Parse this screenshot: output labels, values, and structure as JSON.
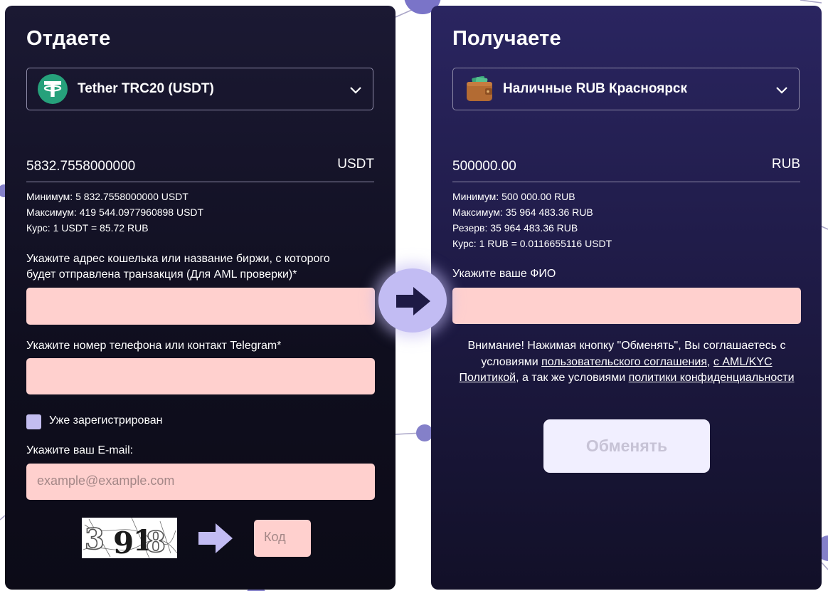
{
  "colors": {
    "input_bg": "#ffd0ce",
    "accent": "#c2bcf3",
    "tether_green": "#26a17b",
    "button_bg": "#f1efff",
    "button_text": "#c7c3d6"
  },
  "give": {
    "title": "Отдаете",
    "currency": {
      "name": "Tether TRC20 (USDT)",
      "icon": "tether-icon"
    },
    "amount": "5832.7558000000",
    "amount_currency": "USDT",
    "min": "Минимум: 5 832.7558000000 USDT",
    "max": "Максимум: 419 544.0977960898 USDT",
    "rate": "Курс: 1 USDT = 85.72 RUB",
    "wallet_label_line1": "Укажите адрес кошелька или название биржи, с которого",
    "wallet_label_line2": "будет отправлена транзакция (Для AML проверки)*",
    "wallet_value": "",
    "phone_label": "Укажите номер телефона или контакт Telegram*",
    "phone_value": "",
    "registered_label": "Уже зарегистрирован",
    "registered_checked": false,
    "email_label": "Укажите ваш E-mail:",
    "email_placeholder": "example@example.com",
    "captcha_text": "3918",
    "code_placeholder": "Код"
  },
  "get": {
    "title": "Получаете",
    "currency": {
      "name": "Наличные RUB Красноярск",
      "icon": "wallet-icon"
    },
    "amount": "500000.00",
    "amount_currency": "RUB",
    "min": "Минимум: 500 000.00 RUB",
    "max": "Максимум: 35 964 483.36 RUB",
    "reserve": "Резерв: 35 964 483.36 RUB",
    "rate": "Курс: 1 RUB = 0.0116655116 USDT",
    "fio_label": "Укажите ваше ФИО",
    "fio_value": "",
    "notice": {
      "part1": "Внимание! Нажимая кнопку \"Обменять\", Вы соглашаетесь с условиями ",
      "link1": "пользовательского соглашения",
      "part2": ", ",
      "link2": "с AML/KYC Политикой",
      "part3": ", а так же условиями ",
      "link3": "политики конфиденциальности"
    },
    "exchange_button": "Обменять"
  }
}
